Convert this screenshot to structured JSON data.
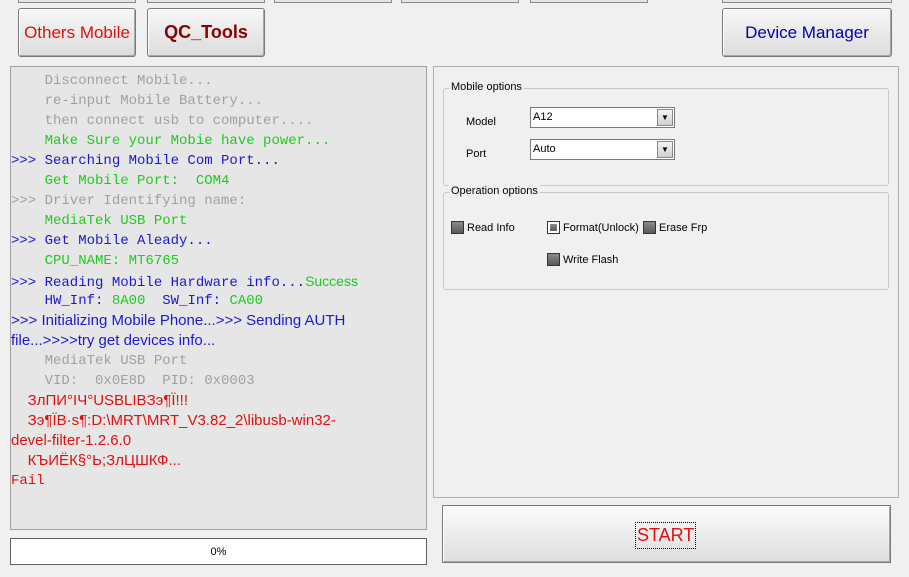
{
  "tabs": {
    "others_mobile": "Others Mobile",
    "qc_tools": "QC_Tools",
    "device_manager": "Device Manager"
  },
  "log": {
    "lines": [
      {
        "text": "    Disconnect Mobile...",
        "color": "gray",
        "font": "mono"
      },
      {
        "text": "    re-input Mobile Battery...",
        "color": "gray",
        "font": "mono"
      },
      {
        "text": "    then connect usb to computer....",
        "color": "gray",
        "font": "mono"
      },
      {
        "text": "    Make Sure your Mobie have power...",
        "color": "green",
        "font": "mono"
      },
      {
        "text": ">>> Searching Mobile Com Port...",
        "color": "blue",
        "font": "mono"
      },
      {
        "text": "    Get Mobile Port:  COM4",
        "color": "green",
        "font": "mono"
      },
      {
        "text": ">>> Driver Identifying name:",
        "color": "gray",
        "font": "mono"
      },
      {
        "text": "    MediaTek USB Port",
        "color": "green",
        "font": "mono"
      },
      {
        "text": ">>> Get Mobile Aleady...",
        "color": "blue",
        "font": "mono"
      },
      {
        "text": "    CPU_NAME: MT6765",
        "color": "green",
        "font": "mono"
      },
      {
        "text": ">>> Reading Mobile Hardware info...",
        "color": "blue",
        "font": "mono",
        "suffix": "Success",
        "suffix_color": "green"
      },
      {
        "text": "    HW_Inf: ",
        "color": "blue",
        "font": "mono",
        "parts": [
          {
            "text": "    HW_Inf: ",
            "color": "blue"
          },
          {
            "text": "8A00",
            "color": "green"
          },
          {
            "text": "  SW_Inf: ",
            "color": "blue"
          },
          {
            "text": "CA00",
            "color": "green"
          }
        ]
      },
      {
        "text": ">>> Initializing Mobile Phone...>>> Sending AUTH",
        "color": "blue",
        "font": "sans"
      },
      {
        "text": "file...>>>>try get devices info...",
        "color": "blue",
        "font": "sans"
      },
      {
        "text": "    MediaTek USB Port",
        "color": "gray",
        "font": "mono"
      },
      {
        "text": "    VID:  0x0E8D  PID: 0x0003",
        "color": "gray",
        "font": "mono"
      },
      {
        "text": "    ЗлПИ°ІЧ°USBLIBЗэ¶Ї!!!",
        "color": "red",
        "font": "sans"
      },
      {
        "text": "    Зэ¶ЇВ·s¶:D:\\MRT\\MRT_V3.82_2\\libusb-win32-",
        "color": "red",
        "font": "sans"
      },
      {
        "text": "devel-filter-1.2.6.0",
        "color": "red",
        "font": "sans"
      },
      {
        "text": "    КЪИЁК§°Ь;ЗлЦШКФ...",
        "color": "red",
        "font": "sans"
      },
      {
        "text": "Fail",
        "color": "red",
        "font": "mono"
      }
    ]
  },
  "progress": {
    "label": "0%",
    "value": 0
  },
  "mobile_options": {
    "title": "Mobile options",
    "model_label": "Model",
    "model_value": "A12",
    "port_label": "Port",
    "port_value": "Auto"
  },
  "operation_options": {
    "title": "Operation options",
    "read_info": "Read Info",
    "format_unlock": "Format(Unlock)",
    "erase_frp": "Erase Frp",
    "write_flash": "Write Flash",
    "selected": "format_unlock"
  },
  "start_button": {
    "label": "START"
  },
  "colors": {
    "gray": "#a0a0a0",
    "green": "#1ccc1c",
    "blue": "#1a1ad0",
    "red": "#e01010"
  }
}
